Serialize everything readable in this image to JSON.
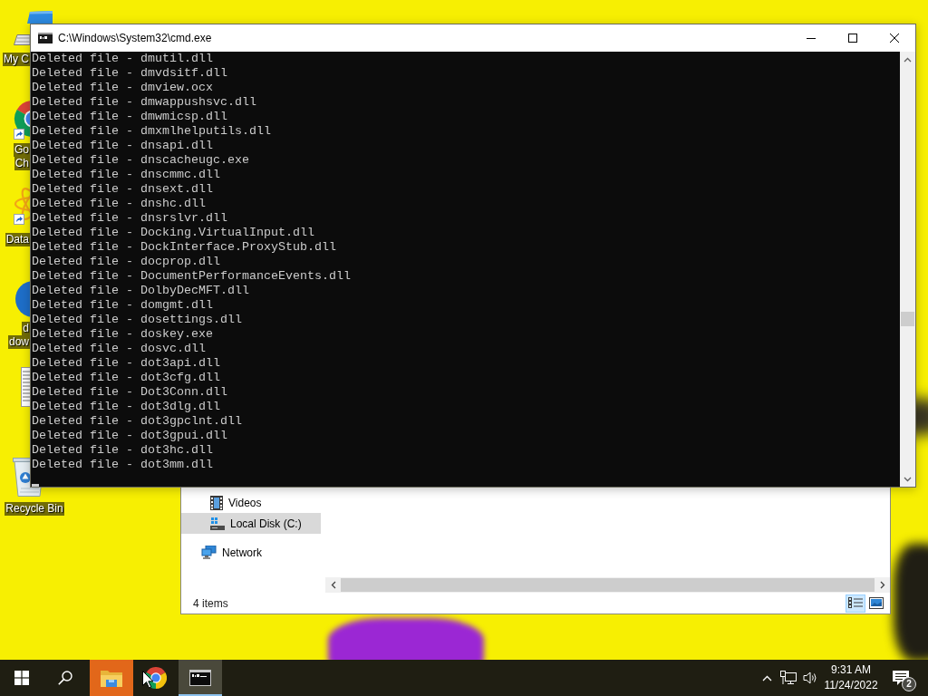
{
  "desktop": {
    "icons": [
      {
        "kind": "computer",
        "shortcut": false,
        "label_lines": [
          "My C"
        ]
      },
      {
        "kind": "chrome",
        "shortcut": true,
        "label_lines": [
          "Go",
          "Ch"
        ]
      },
      {
        "kind": "atom",
        "shortcut": true,
        "label_lines": [
          "Data"
        ]
      },
      {
        "kind": "globe",
        "shortcut": false,
        "label_lines": [
          "d",
          "dow"
        ]
      },
      {
        "kind": "document",
        "shortcut": false
      },
      {
        "kind": "recycle-bin",
        "shortcut": false,
        "label_lines": [
          "Recycle Bin"
        ]
      }
    ]
  },
  "cmd_window": {
    "title": "C:\\Windows\\System32\\cmd.exe",
    "lines": [
      "Deleted file - dmutil.dll",
      "Deleted file - dmvdsitf.dll",
      "Deleted file - dmview.ocx",
      "Deleted file - dmwappushsvc.dll",
      "Deleted file - dmwmicsp.dll",
      "Deleted file - dmxmlhelputils.dll",
      "Deleted file - dnsapi.dll",
      "Deleted file - dnscacheugc.exe",
      "Deleted file - dnscmmc.dll",
      "Deleted file - dnsext.dll",
      "Deleted file - dnshc.dll",
      "Deleted file - dnsrslvr.dll",
      "Deleted file - Docking.VirtualInput.dll",
      "Deleted file - DockInterface.ProxyStub.dll",
      "Deleted file - docprop.dll",
      "Deleted file - DocumentPerformanceEvents.dll",
      "Deleted file - DolbyDecMFT.dll",
      "Deleted file - domgmt.dll",
      "Deleted file - dosettings.dll",
      "Deleted file - doskey.exe",
      "Deleted file - dosvc.dll",
      "Deleted file - dot3api.dll",
      "Deleted file - dot3cfg.dll",
      "Deleted file - Dot3Conn.dll",
      "Deleted file - dot3dlg.dll",
      "Deleted file - dot3gpclnt.dll",
      "Deleted file - dot3gpui.dll",
      "Deleted file - dot3hc.dll",
      "Deleted file - dot3mm.dll"
    ]
  },
  "explorer_window": {
    "nav_tree": [
      {
        "children": [
          {
            "kind": "videos",
            "label": "Videos",
            "selected": false
          },
          {
            "kind": "disk",
            "label": "Local Disk (C:)",
            "selected": true
          }
        ]
      },
      {
        "kind": "network",
        "label": "Network",
        "selected": false
      }
    ],
    "status": "4 items",
    "views": [
      {
        "kind": "details",
        "selected": true
      },
      {
        "kind": "large-icons",
        "selected": false
      }
    ]
  },
  "taskbar": {
    "apps": [
      {
        "kind": "file-explorer",
        "selected": false,
        "flashing": true
      },
      {
        "kind": "chrome",
        "selected": false,
        "flashing": false
      },
      {
        "kind": "cmd",
        "selected": true,
        "flashing": false
      }
    ],
    "clock": {
      "time": "9:31 AM",
      "date": "11/24/2022"
    },
    "notification_count": "2"
  }
}
